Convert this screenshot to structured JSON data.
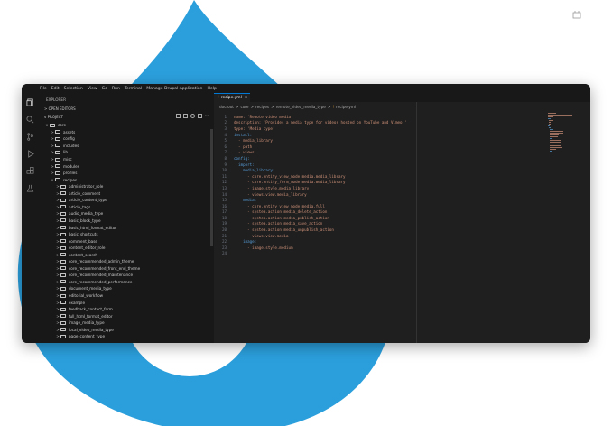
{
  "menu": [
    "File",
    "Edit",
    "Selection",
    "View",
    "Go",
    "Run",
    "Terminal",
    "Manage Drupal Application",
    "Help"
  ],
  "sidebar": {
    "title": "EXPLORER",
    "open_editors": "OPEN EDITORS",
    "project": "PROJECT",
    "tree": [
      {
        "label": "core",
        "chev": "v",
        "d": 1
      },
      {
        "label": "assets",
        "chev": ">",
        "d": 2
      },
      {
        "label": "config",
        "chev": ">",
        "d": 2
      },
      {
        "label": "includes",
        "chev": ">",
        "d": 2
      },
      {
        "label": "lib",
        "chev": ">",
        "d": 2
      },
      {
        "label": "misc",
        "chev": ">",
        "d": 2
      },
      {
        "label": "modules",
        "chev": ">",
        "d": 2
      },
      {
        "label": "profiles",
        "chev": ">",
        "d": 2
      },
      {
        "label": "recipes",
        "chev": "v",
        "d": 2
      },
      {
        "label": "administrator_role",
        "chev": ">",
        "d": 3
      },
      {
        "label": "article_comment",
        "chev": ">",
        "d": 3
      },
      {
        "label": "article_content_type",
        "chev": ">",
        "d": 3
      },
      {
        "label": "article_tags",
        "chev": ">",
        "d": 3
      },
      {
        "label": "audio_media_type",
        "chev": ">",
        "d": 3
      },
      {
        "label": "basic_block_type",
        "chev": ">",
        "d": 3
      },
      {
        "label": "basic_html_format_editor",
        "chev": ">",
        "d": 3
      },
      {
        "label": "basic_shortcuts",
        "chev": ">",
        "d": 3
      },
      {
        "label": "comment_base",
        "chev": ">",
        "d": 3
      },
      {
        "label": "content_editor_role",
        "chev": ">",
        "d": 3
      },
      {
        "label": "content_search",
        "chev": ">",
        "d": 3
      },
      {
        "label": "core_recommended_admin_theme",
        "chev": ">",
        "d": 3
      },
      {
        "label": "core_recommended_front_end_theme",
        "chev": ">",
        "d": 3
      },
      {
        "label": "core_recommended_maintenance",
        "chev": ">",
        "d": 3
      },
      {
        "label": "core_recommended_performance",
        "chev": ">",
        "d": 3
      },
      {
        "label": "document_media_type",
        "chev": ">",
        "d": 3
      },
      {
        "label": "editorial_workflow",
        "chev": ">",
        "d": 3
      },
      {
        "label": "example",
        "chev": ">",
        "d": 3
      },
      {
        "label": "feedback_contact_form",
        "chev": ">",
        "d": 3
      },
      {
        "label": "full_html_format_editor",
        "chev": ">",
        "d": 3
      },
      {
        "label": "image_media_type",
        "chev": ">",
        "d": 3
      },
      {
        "label": "local_video_media_type",
        "chev": ">",
        "d": 3
      },
      {
        "label": "page_content_type",
        "chev": ">",
        "d": 3
      }
    ]
  },
  "editor": {
    "tab": {
      "icon": "!",
      "label": "recipe.yml"
    },
    "breadcrumb": [
      "docroot",
      ">",
      "core",
      ">",
      "recipes",
      ">",
      "remote_video_media_type",
      ">",
      "!",
      "recipe.yml"
    ],
    "lines": [
      {
        "n": "1",
        "t": "name: 'Remote video media'",
        "c": "#ce9178"
      },
      {
        "n": "2",
        "t": "description: 'Provides a media type for videos hosted on YouTube and Vimeo.'",
        "c": "#ce9178"
      },
      {
        "n": "3",
        "t": "type: 'Media type'",
        "c": "#ce9178"
      },
      {
        "n": "4",
        "t": "install:",
        "c": "#569cd6"
      },
      {
        "n": "5",
        "t": "  - media_library",
        "c": "#ce9178"
      },
      {
        "n": "6",
        "t": "  - path",
        "c": "#ce9178"
      },
      {
        "n": "7",
        "t": "  - views",
        "c": "#ce9178"
      },
      {
        "n": "8",
        "t": "config:",
        "c": "#569cd6"
      },
      {
        "n": "9",
        "t": "  import:",
        "c": "#569cd6"
      },
      {
        "n": "10",
        "t": "    media_library:",
        "c": "#569cd6"
      },
      {
        "n": "11",
        "t": "      - core.entity_view_mode.media.media_library",
        "c": "#ce9178"
      },
      {
        "n": "12",
        "t": "      - core.entity_form_mode.media.media_library",
        "c": "#ce9178"
      },
      {
        "n": "13",
        "t": "      - image.style.media_library",
        "c": "#ce9178"
      },
      {
        "n": "14",
        "t": "      - views.view.media_library",
        "c": "#ce9178"
      },
      {
        "n": "15",
        "t": "    media:",
        "c": "#569cd6"
      },
      {
        "n": "16",
        "t": "      - core.entity_view_mode.media.full",
        "c": "#ce9178"
      },
      {
        "n": "17",
        "t": "      - system.action.media_delete_action",
        "c": "#ce9178"
      },
      {
        "n": "18",
        "t": "      - system.action.media_publish_action",
        "c": "#ce9178"
      },
      {
        "n": "19",
        "t": "      - system.action.media_save_action",
        "c": "#ce9178"
      },
      {
        "n": "20",
        "t": "      - system.action.media_unpublish_action",
        "c": "#ce9178"
      },
      {
        "n": "21",
        "t": "      - views.view.media",
        "c": "#ce9178"
      },
      {
        "n": "22",
        "t": "    image:",
        "c": "#569cd6"
      },
      {
        "n": "23",
        "t": "      - image.style.medium",
        "c": "#ce9178"
      },
      {
        "n": "24",
        "t": "",
        "c": "#ce9178"
      }
    ]
  },
  "colors": {
    "drop": "#2b9fdc",
    "window": "#1f1f1f",
    "accent": "#0078d4"
  }
}
